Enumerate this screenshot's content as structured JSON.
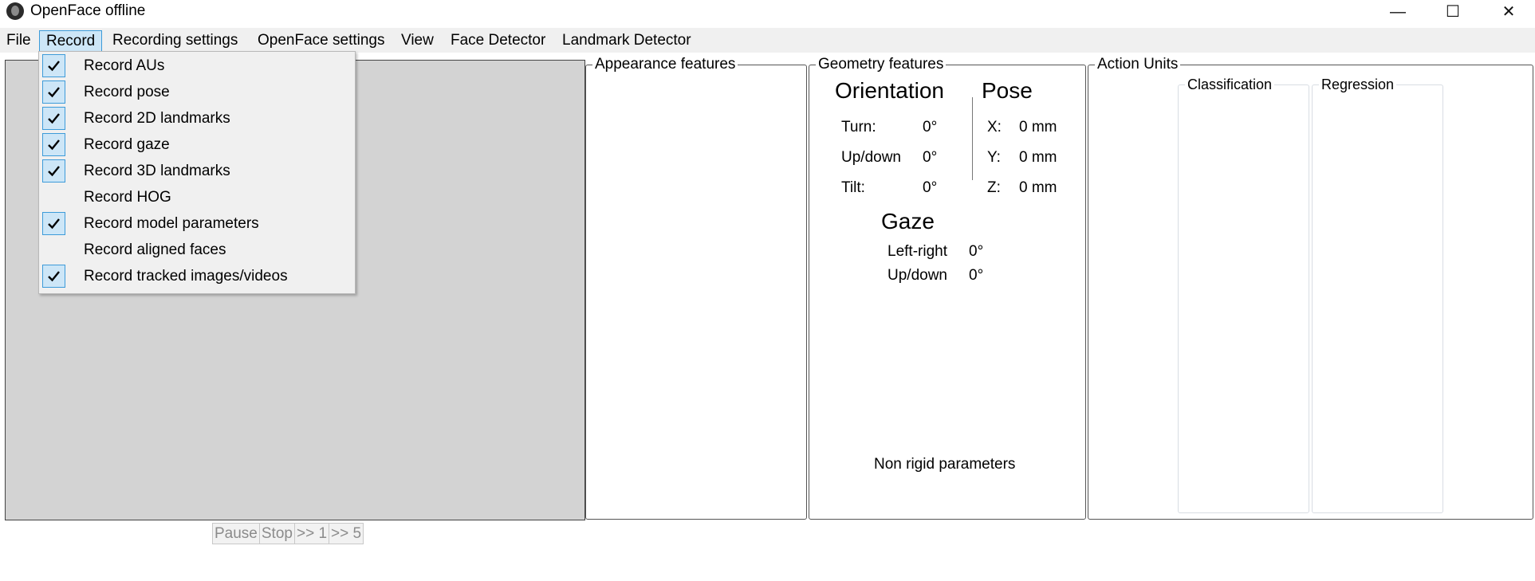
{
  "window": {
    "title": "OpenFace offline",
    "icon": "app-icon",
    "controls": {
      "minimize": "—",
      "maximize": "☐",
      "close": "✕"
    }
  },
  "menubar": {
    "items": [
      {
        "label": "File"
      },
      {
        "label": "Record",
        "open": true
      },
      {
        "label": "Recording settings"
      },
      {
        "label": "OpenFace settings"
      },
      {
        "label": "View"
      },
      {
        "label": "Face Detector"
      },
      {
        "label": "Landmark Detector"
      }
    ]
  },
  "record_menu": {
    "items": [
      {
        "label": "Record AUs",
        "checked": true
      },
      {
        "label": "Record pose",
        "checked": true
      },
      {
        "label": "Record 2D landmarks",
        "checked": true
      },
      {
        "label": "Record gaze",
        "checked": true
      },
      {
        "label": "Record 3D landmarks",
        "checked": true
      },
      {
        "label": "Record HOG",
        "checked": false
      },
      {
        "label": "Record model parameters",
        "checked": true
      },
      {
        "label": "Record aligned faces",
        "checked": false
      },
      {
        "label": "Record tracked images/videos",
        "checked": true
      }
    ]
  },
  "playback": {
    "pause": "Pause",
    "stop": "Stop",
    "step1": ">> 1",
    "step5": ">> 5"
  },
  "appearance": {
    "title": "Appearance features"
  },
  "geometry": {
    "title": "Geometry features",
    "orientation": {
      "heading": "Orientation",
      "turn_label": "Turn:",
      "turn_value": "0°",
      "updown_label": "Up/down:",
      "updown_value": "0°",
      "tilt_label": "Tilt:",
      "tilt_value": "0°"
    },
    "pose": {
      "heading": "Pose",
      "x_label": "X:",
      "x_value": "0 mm",
      "y_label": "Y:",
      "y_value": "0 mm",
      "z_label": "Z:",
      "z_value": "0 mm"
    },
    "gaze": {
      "heading": "Gaze",
      "lr_label": "Left-right:",
      "lr_value": "0°",
      "ud_label": "Up/down:",
      "ud_value": "0°"
    },
    "nonrigid_label": "Non rigid parameters"
  },
  "action_units": {
    "title": "Action Units",
    "classification": "Classification",
    "regression": "Regression"
  },
  "colors": {
    "accent": "#3d9bd9",
    "highlight": "#cde6f7",
    "menu_bg": "#f0f0f0",
    "video_bg": "#d3d3d3"
  }
}
